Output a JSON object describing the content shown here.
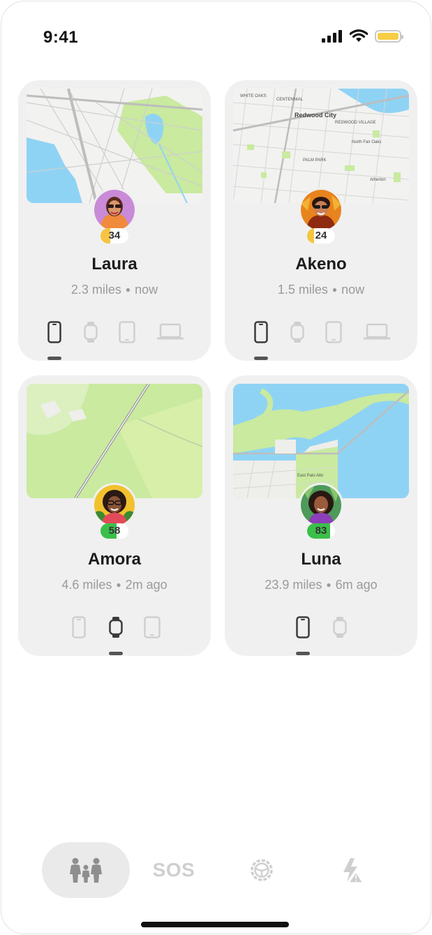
{
  "status_bar": {
    "time": "9:41"
  },
  "people": [
    {
      "name": "Laura",
      "distance": "2.3 miles",
      "updated": "now",
      "battery": "34",
      "battery_color": "#f5c542",
      "battery_level": 0.34
    },
    {
      "name": "Akeno",
      "distance": "1.5 miles",
      "updated": "now",
      "battery": "24",
      "battery_color": "#f5c542",
      "battery_level": 0.24
    },
    {
      "name": "Amora",
      "distance": "4.6 miles",
      "updated": "2m ago",
      "battery": "58",
      "battery_color": "#3bbf4a",
      "battery_level": 0.58
    },
    {
      "name": "Luna",
      "distance": "23.9 miles",
      "updated": "6m ago",
      "battery": "83",
      "battery_color": "#3bbf4a",
      "battery_level": 0.83
    }
  ],
  "devices": {
    "laura": [
      "phone-icon",
      "watch-icon",
      "tablet-icon",
      "laptop-icon"
    ],
    "akeno": [
      "phone-icon",
      "watch-icon",
      "tablet-icon",
      "laptop-icon"
    ],
    "amora": [
      "phone-icon",
      "watch-icon",
      "tablet-icon"
    ],
    "luna": [
      "phone-icon",
      "watch-icon"
    ]
  },
  "map_labels": {
    "akeno": [
      "CENTENNIAL",
      "WHITE OAKS",
      "Redwood City",
      "REDWOOD VILLAGE",
      "North Fair Oaks",
      "PALM PARK",
      "Atherton"
    ],
    "luna": [
      "East Palo Alto"
    ]
  },
  "tabs": {
    "sos_label": "SOS"
  },
  "colors": {
    "card_bg": "#f0f0f0",
    "active_device": "#3a3a3a",
    "inactive_device": "#cfcfcf",
    "map_water": "#8fd3f4",
    "map_green": "#c9ea9f"
  }
}
